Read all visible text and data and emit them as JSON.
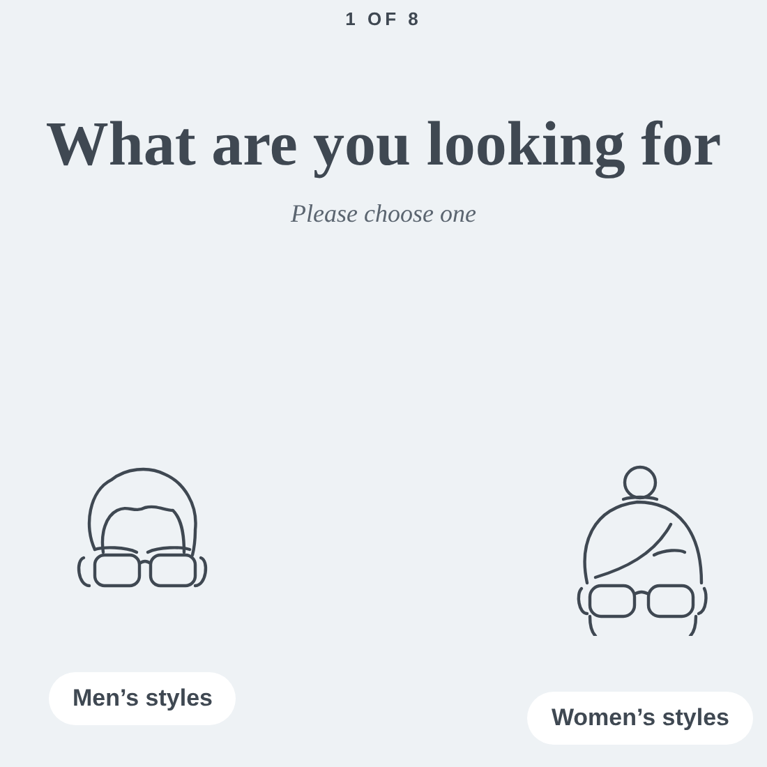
{
  "step": "1 OF 8",
  "title": "What are you looking for",
  "subtitle": "Please choose one",
  "options": [
    {
      "kind": "men",
      "label": "Men’s styles"
    },
    {
      "kind": "women",
      "label": "Women’s styles"
    }
  ]
}
